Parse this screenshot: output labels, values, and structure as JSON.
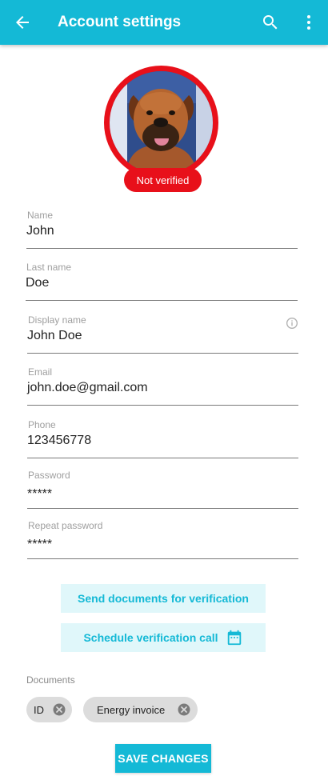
{
  "appbar": {
    "title": "Account settings",
    "icons": [
      "back-arrow-icon",
      "search-icon",
      "more-vert-icon"
    ],
    "color": "#14b9d6"
  },
  "profile": {
    "avatar": "dog-photo",
    "status": "Not verified",
    "status_color": "#e8101a"
  },
  "form": {
    "name": {
      "label": "Name",
      "value": "John"
    },
    "last_name": {
      "label": "Last name",
      "value": "Doe"
    },
    "display_name": {
      "label": "Display name",
      "value": "John Doe",
      "icon": "info-icon"
    },
    "email": {
      "label": "Email",
      "value": "john.doe@gmail.com"
    },
    "phone": {
      "label": "Phone",
      "value": "123456778"
    },
    "password": {
      "label": "Password",
      "value": "*****"
    },
    "repeat_password": {
      "label": "Repeat password",
      "value": "*****"
    }
  },
  "actions": {
    "send_documents": "Send documents for verification",
    "schedule_call": "Schedule verification call",
    "schedule_icon": "calendar-icon"
  },
  "documents": {
    "label": "Documents",
    "items": [
      {
        "label": "ID"
      },
      {
        "label": "Energy invoice"
      }
    ]
  },
  "save_button": "SAVE CHANGES"
}
